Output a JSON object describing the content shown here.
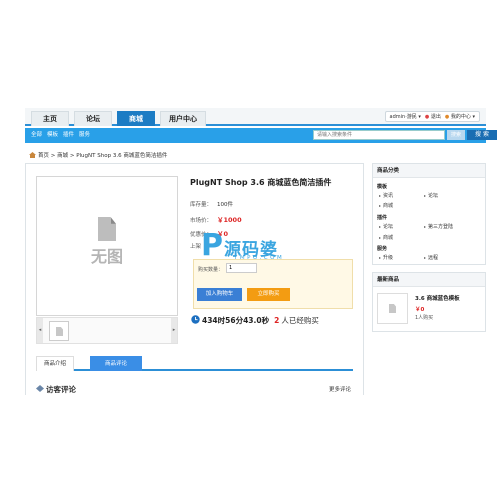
{
  "nav": {
    "tabs": [
      "主页",
      "论坛",
      "商城",
      "用户中心"
    ],
    "active_tab": "商城",
    "user": {
      "name": "admin",
      "separator": "·",
      "status": "游民",
      "logout": "退出",
      "my_center": "我的中心"
    }
  },
  "subnav": {
    "links": [
      "全部",
      "模板",
      "插件",
      "服务"
    ],
    "search_placeholder": "请输入搜索条件",
    "search_aux_label": "搜索",
    "search_button": "搜 索"
  },
  "breadcrumb": "首页 > 商城 > PlugNT Shop 3.6 商城蓝色简洁插件",
  "product": {
    "title": "PlugNT Shop 3.6 商城蓝色简洁插件",
    "stock_label": "库存量：",
    "stock_value": "100件",
    "market_price_label": "市场价：",
    "market_price_value": "￥1000",
    "discount_label": "优惠价：",
    "discount_value": "￥0",
    "shelf_label": "上架",
    "qty_label": "购买数量：",
    "qty_value": "1",
    "add_cart_button": "加入购物车",
    "buy_now_button": "立即购买",
    "no_image_text": "无图",
    "countdown_text": "434时56分43.0秒",
    "buyers_count": "2",
    "buyers_text": "人已经购买"
  },
  "detail_tabs": [
    "商品介绍",
    "商品评论"
  ],
  "active_detail_tab": "商品评论",
  "comments": {
    "title": "访客评论",
    "more": "更多评论"
  },
  "sidebar": {
    "categories_title": "商品分类",
    "groups": [
      {
        "name": "模板",
        "items": [
          "资讯",
          "论坛",
          "商城"
        ]
      },
      {
        "name": "插件",
        "items": [
          "论坛",
          "第三方登陆",
          "商城"
        ]
      },
      {
        "name": "服务",
        "items": [
          "升级",
          "远程"
        ]
      }
    ],
    "new_products_title": "最新商品",
    "new_product": {
      "name": "3.6 商城蓝色模板",
      "price": "￥0",
      "buyers": "1人购买"
    }
  },
  "watermark": {
    "letter": "P",
    "text": "源码婆",
    "url": "YMPO.COM"
  },
  "colors": {
    "primary_blue": "#1c7cc4",
    "subnav_blue": "#29a0e8",
    "price_red": "#dd2222",
    "buy_orange": "#f39c12"
  }
}
